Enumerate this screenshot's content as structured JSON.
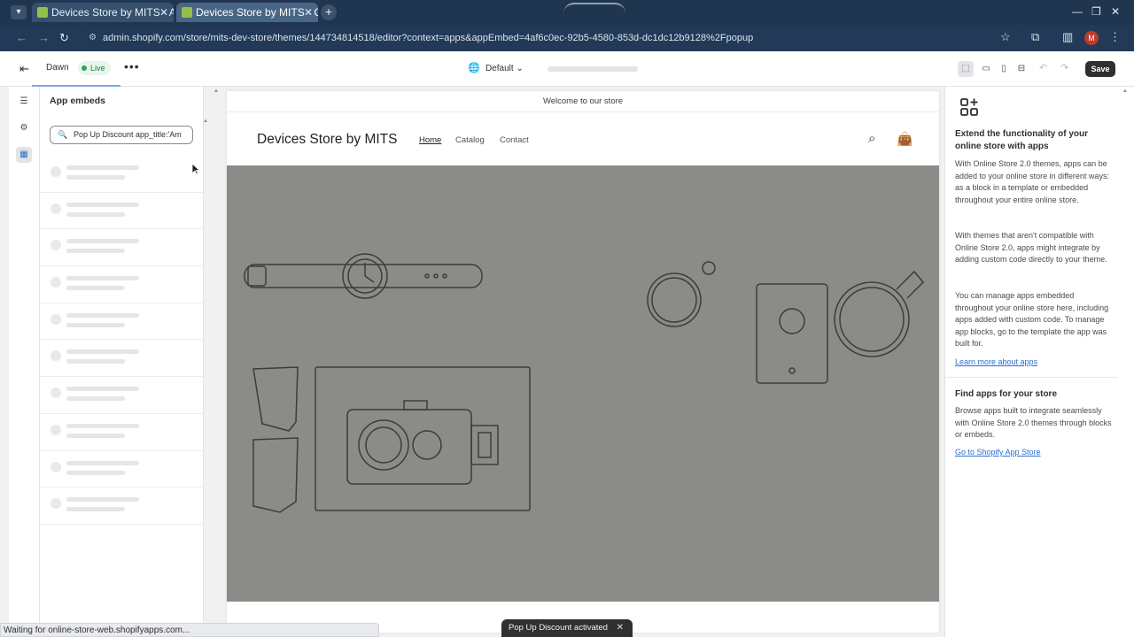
{
  "browser": {
    "tabs": [
      {
        "title": "Devices Store by MITS · A",
        "active": false
      },
      {
        "title": "Devices Store by MITS · C",
        "active": true
      }
    ],
    "url": "admin.shopify.com/store/mits-dev-store/themes/144734814518/editor?context=apps&appEmbed=4af6c0ec-92b5-4580-853d-dc1dc12b9128%2Fpopup",
    "profile_initial": "M",
    "status_text": "Waiting for online-store-web.shopifyapps.com..."
  },
  "editor": {
    "theme_name": "Dawn",
    "live_badge": "Live",
    "locale": "Default",
    "save_label": "Save"
  },
  "panel": {
    "title": "App embeds",
    "search_value": "Pop Up Discount app_title:'Am"
  },
  "preview": {
    "announcement": "Welcome to our store",
    "store_name": "Devices Store by MITS",
    "nav": [
      "Home",
      "Catalog",
      "Contact"
    ]
  },
  "info": {
    "heading1": "Extend the functionality of your online store with apps",
    "para1": "With Online Store 2.0 themes, apps can be added to your online store in different ways: as a block in a template or embedded throughout your entire online store.",
    "para2": "With themes that aren't compatible with Online Store 2.0, apps might integrate by adding custom code directly to your theme.",
    "para3": "You can manage apps embedded throughout your online store here, including apps added with custom code. To manage app blocks, go to the template the app was built for.",
    "link1": "Learn more about apps",
    "heading2": "Find apps for your store",
    "para4": "Browse apps built to integrate seamlessly with Online Store 2.0 themes through blocks or embeds.",
    "link2": "Go to Shopify App Store"
  },
  "toast": {
    "message": "Pop Up Discount activated"
  },
  "colors": {
    "browser_frame": "#1f3550",
    "hero_bg": "#8b8c88",
    "save_button": "#303030",
    "link": "#2c6ecb",
    "live_badge": "#1a7a3e"
  }
}
